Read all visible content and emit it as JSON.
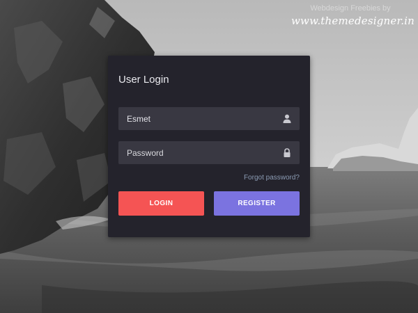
{
  "credit": {
    "line1": "Webdesign Freebies by",
    "site": "www.themedesigner.in"
  },
  "login_form": {
    "title": "User Login",
    "username_value": "Esmet",
    "username_icon": "user-icon",
    "password_placeholder": "Password",
    "password_icon": "lock-icon",
    "forgot_label": "Forgot password?",
    "login_label": "LOGIN",
    "register_label": "REGISTER"
  },
  "colors": {
    "card_bg": "#24232c",
    "field_bg": "#393842",
    "login_button": "#f55454",
    "register_button": "#7b73e0",
    "link": "#8b9bb3"
  }
}
